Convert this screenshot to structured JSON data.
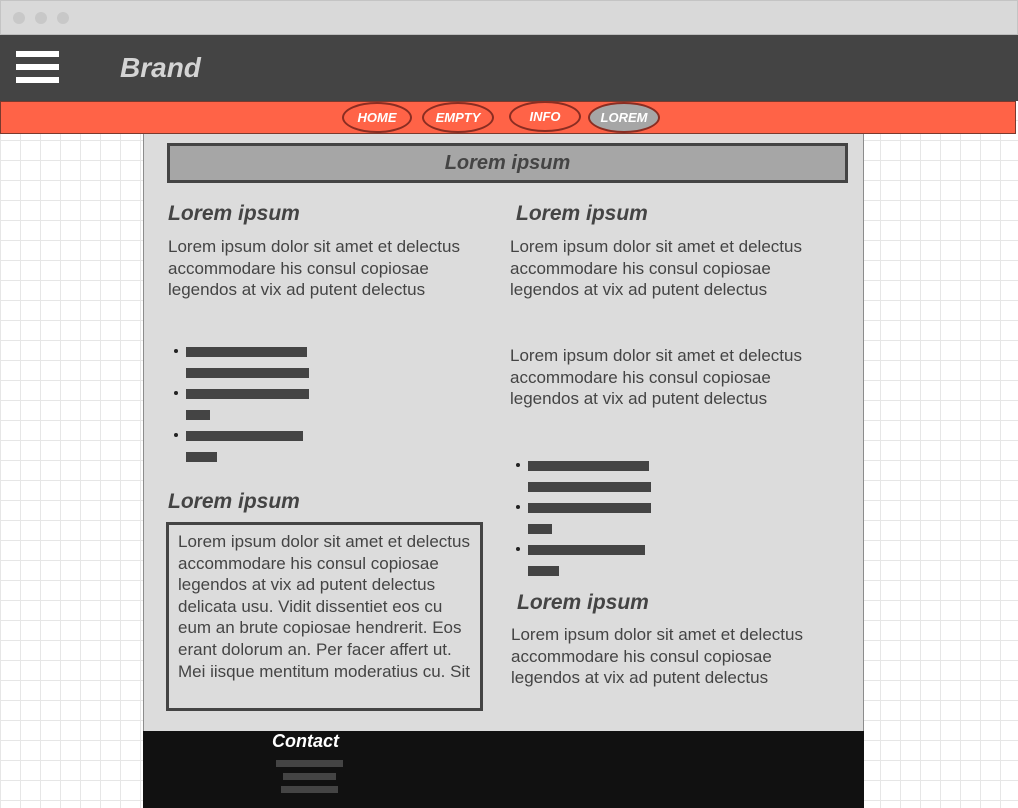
{
  "window": {
    "controls": [
      "close",
      "minimize",
      "maximize"
    ]
  },
  "header": {
    "brand": "Brand",
    "menu_icon": "hamburger-icon"
  },
  "nav": {
    "items": [
      {
        "label": "HOME",
        "active": false
      },
      {
        "label": "EMPTY",
        "active": false
      },
      {
        "label": "INFO",
        "active": false
      },
      {
        "label": "LOREM",
        "active": true
      }
    ]
  },
  "main": {
    "banner": "Lorem ipsum",
    "left": {
      "heading1": "Lorem ipsum",
      "para1": "Lorem ipsum dolor sit amet et delectus accommodare his consul copiosae legendos at vix ad putent delectus",
      "heading2": "Lorem ipsum",
      "box_text": "Lorem ipsum dolor sit amet et delectus accommodare his consul copiosae legendos at vix ad putent delectus delicata usu. Vidit dissentiet eos cu eum an brute copiosae hendrerit. Eos erant dolorum an. Per facer affert ut. Mei iisque mentitum moderatius cu. Sit"
    },
    "right": {
      "heading1": "Lorem ipsum",
      "para1": "Lorem ipsum dolor sit amet et delectus accommodare his consul copiosae legendos at vix ad putent delectus",
      "para2": "Lorem ipsum dolor sit amet et delectus accommodare his consul copiosae legendos at vix ad putent delectus",
      "heading2": "Lorem ipsum",
      "para3": "Lorem ipsum dolor sit amet et delectus accommodare his consul copiosae legendos at vix ad putent delectus"
    }
  },
  "footer": {
    "title": "Contact"
  },
  "colors": {
    "header_bg": "#444444",
    "nav_bg": "#ff6347",
    "nav_active": "#a6a6a6",
    "content_bg": "#dcdcdc",
    "footer_bg": "#111111",
    "text": "#444444"
  }
}
